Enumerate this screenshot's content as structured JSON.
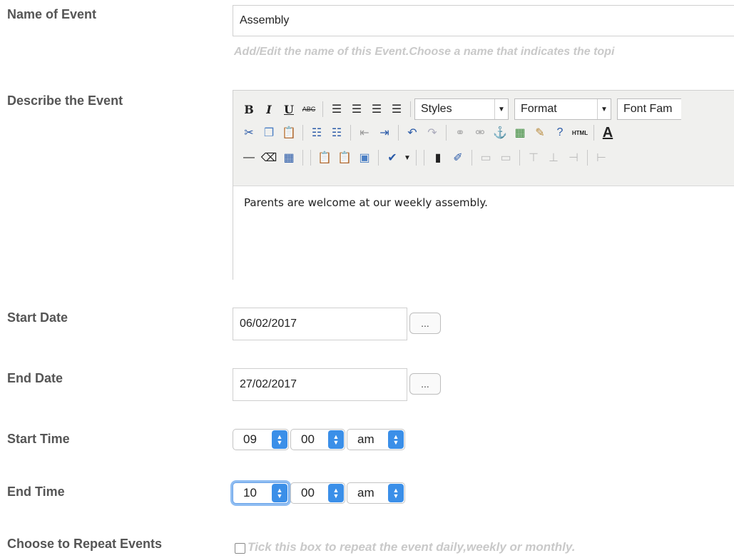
{
  "labels": {
    "name_of_event": "Name of Event",
    "describe_event": "Describe the Event",
    "start_date": "Start Date",
    "end_date": "End Date",
    "start_time": "Start Time",
    "end_time": "End Time",
    "repeat_events": "Choose to Repeat Events"
  },
  "event_name": {
    "value": "Assembly",
    "hint": "Add/Edit the name of this Event.Choose a name that indicates the topi"
  },
  "editor": {
    "toolbar": {
      "styles": "Styles",
      "format": "Format",
      "font_family": "Font Fam",
      "html_label": "HTML"
    },
    "content": "Parents are welcome at our weekly assembly."
  },
  "start_date": {
    "value": "06/02/2017",
    "picker": "..."
  },
  "end_date": {
    "value": "27/02/2017",
    "picker": "..."
  },
  "start_time": {
    "hour": "09",
    "minute": "00",
    "ampm": "am"
  },
  "end_time": {
    "hour": "10",
    "minute": "00",
    "ampm": "am"
  },
  "repeat": {
    "hint": "Tick this box to repeat the event daily,weekly or monthly."
  },
  "colors": {
    "accent": "#3b8fe8",
    "label": "#555555",
    "hint": "#c9c9c9"
  }
}
